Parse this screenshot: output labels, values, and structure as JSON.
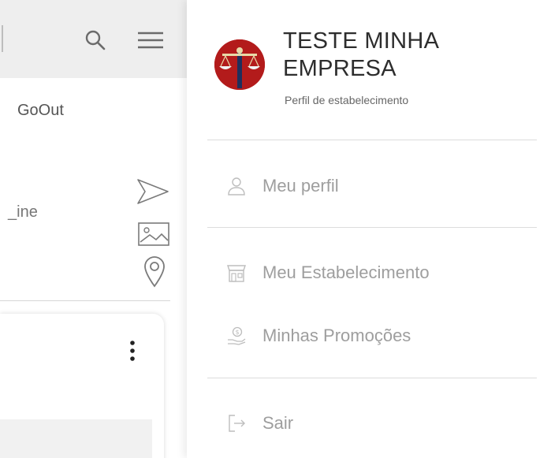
{
  "background": {
    "tab_label": "GoOut",
    "line_label": "_ine"
  },
  "drawer": {
    "company_name_line1": "TESTE MINHA",
    "company_name_line2": "EMPRESA",
    "subtitle": "Perfil de estabelecimento",
    "items": [
      {
        "label": "Meu perfil",
        "icon": "user-icon"
      },
      {
        "label": "Meu Estabelecimento",
        "icon": "store-icon"
      },
      {
        "label": "Minhas Promoções",
        "icon": "promotion-icon"
      },
      {
        "label": "Sair",
        "icon": "logout-icon"
      }
    ]
  },
  "colors": {
    "avatar_bg": "#b31b1b",
    "menu_text": "#9e9e9e",
    "title_text": "#2d2d2d"
  }
}
